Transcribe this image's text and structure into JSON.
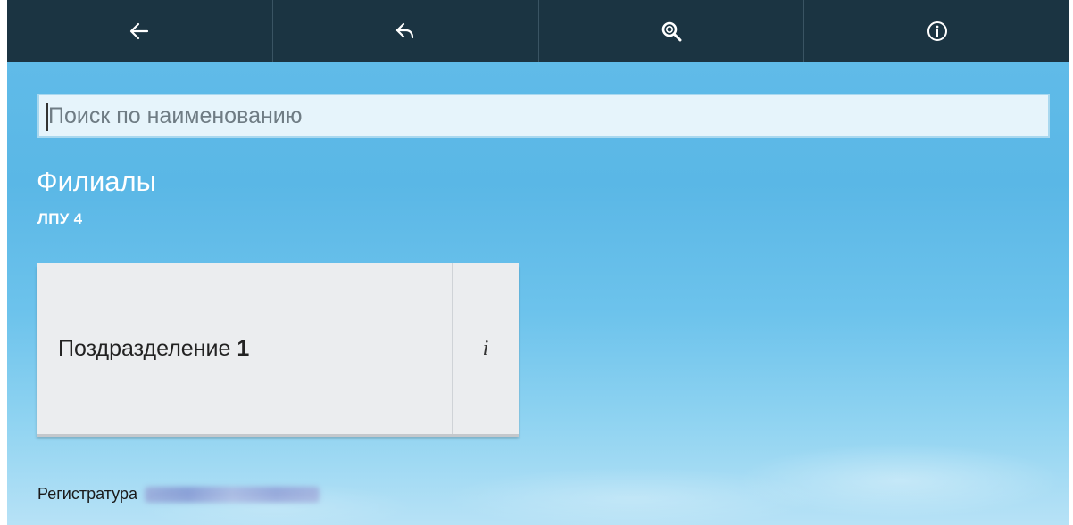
{
  "nav": {
    "buttons": [
      {
        "icon": "arrow-left-icon"
      },
      {
        "icon": "undo-icon"
      },
      {
        "icon": "search-icon"
      },
      {
        "icon": "info-icon"
      }
    ]
  },
  "search": {
    "placeholder": "Поиск по наименованию",
    "value": ""
  },
  "header": {
    "title": "Филиалы",
    "subtitle": "ЛПУ 4"
  },
  "branches": [
    {
      "label": "Поздразделение",
      "number": "1",
      "info_label": "i"
    }
  ],
  "footer": {
    "label": "Регистратура"
  },
  "colors": {
    "topbar": "#1b3442",
    "background": "#63bde9",
    "card": "#ebedef",
    "text_light": "#ffffff"
  }
}
